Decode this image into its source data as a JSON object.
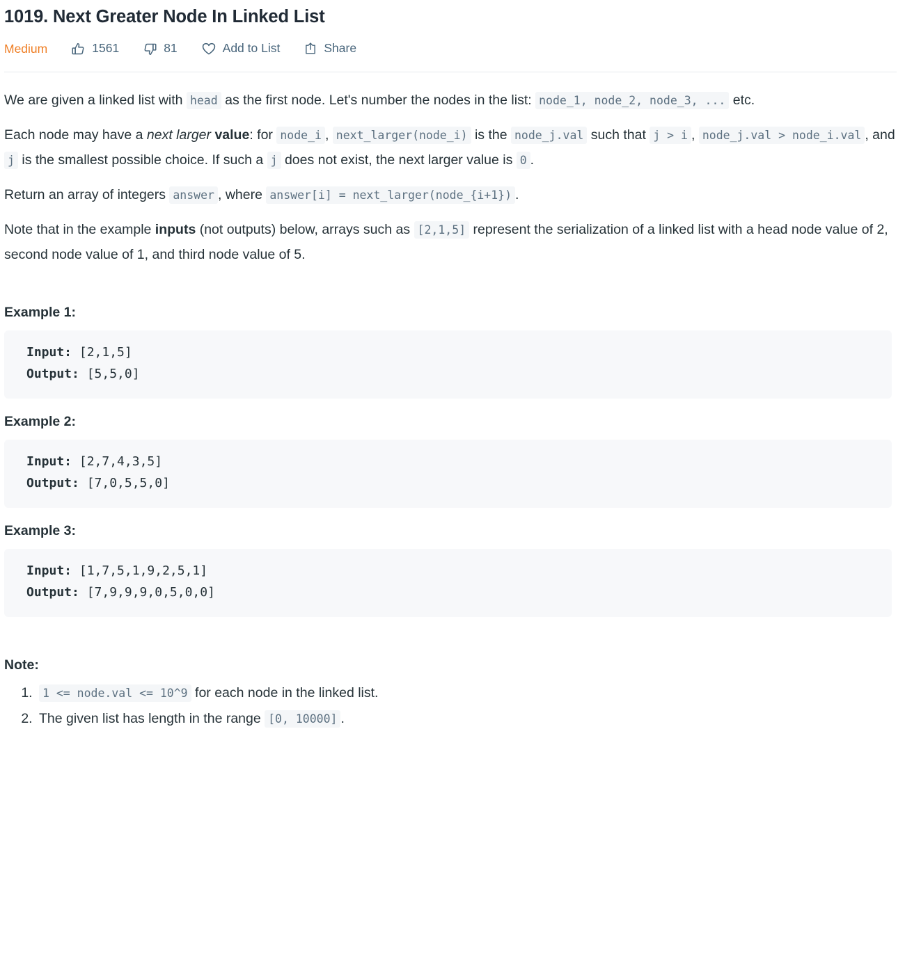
{
  "header": {
    "title": "1019. Next Greater Node In Linked List",
    "difficulty": "Medium",
    "difficulty_color": "#ef7f26",
    "likes": "1561",
    "dislikes": "81",
    "add_to_list_label": "Add to List",
    "share_label": "Share",
    "icons": {
      "like": "thumbs-up-icon",
      "dislike": "thumbs-down-icon",
      "favorite": "heart-icon",
      "share": "share-icon"
    }
  },
  "description": {
    "p1": {
      "t1": "We are given a linked list with ",
      "c1": "head",
      "t2": " as the first node.  Let's number the nodes in the list: ",
      "c2": "node_1, node_2, node_3, ...",
      "t3": " etc."
    },
    "p2": {
      "t1": "Each node may have a ",
      "i1": "next larger",
      "t2": " ",
      "b1": "value",
      "t3": ": for ",
      "c1": "node_i",
      "t4": ", ",
      "c2": "next_larger(node_i)",
      "t5": " is the ",
      "c3": "node_j.val",
      "t6": " such that ",
      "c4": "j > i",
      "t7": ", ",
      "c5": "node_j.val > node_i.val",
      "t8": ", and ",
      "c6": "j",
      "t9": " is the smallest possible choice.  If such a ",
      "c7": "j",
      "t10": " does not exist, the next larger value is ",
      "c8": "0",
      "t11": "."
    },
    "p3": {
      "t1": "Return an array of integers ",
      "c1": "answer",
      "t2": ", where ",
      "c2": "answer[i] = next_larger(node_{i+1})",
      "t3": "."
    },
    "p4": {
      "t1": "Note that in the example ",
      "b1": "inputs",
      "t2": " (not outputs) below, arrays such as ",
      "c1": "[2,1,5]",
      "t3": " represent the serialization of a linked list with a head node value of 2, second node value of 1, and third node value of 5."
    }
  },
  "examples": [
    {
      "heading": "Example 1:",
      "input_label": "Input:",
      "input_value": " [2,1,5]",
      "output_label": "Output:",
      "output_value": " [5,5,0]"
    },
    {
      "heading": "Example 2:",
      "input_label": "Input:",
      "input_value": " [2,7,4,3,5]",
      "output_label": "Output:",
      "output_value": " [7,0,5,5,0]"
    },
    {
      "heading": "Example 3:",
      "input_label": "Input:",
      "input_value": " [1,7,5,1,9,2,5,1]",
      "output_label": "Output:",
      "output_value": " [7,9,9,9,0,5,0,0]"
    }
  ],
  "note": {
    "heading": "Note:",
    "items": [
      {
        "c1": "1 <= node.val <= 10^9",
        "t1": " for each node in the linked list."
      },
      {
        "t0": "The given list has length in the range ",
        "c1": "[0, 10000]",
        "t1": "."
      }
    ]
  }
}
